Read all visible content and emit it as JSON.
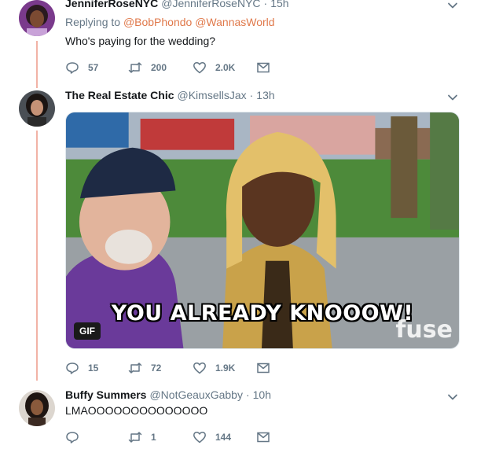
{
  "tweets": [
    {
      "name": "JenniferRoseNYC",
      "handle": "@JenniferRoseNYC",
      "separator": "·",
      "time": "15h",
      "reply_prefix": "Replying to",
      "mentions": [
        "@BobPhondo",
        "@WannasWorld"
      ],
      "text": "Who's paying for the wedding?",
      "stats": {
        "replies": "57",
        "retweets": "200",
        "likes": "2.0K"
      }
    },
    {
      "name": "The Real Estate Chic",
      "handle": "@KimsellsJax",
      "separator": "·",
      "time": "13h",
      "media": {
        "caption": "YOU ALREADY KNOOOW!",
        "badge": "GIF",
        "watermark": "fuse"
      },
      "stats": {
        "replies": "15",
        "retweets": "72",
        "likes": "1.9K"
      }
    },
    {
      "name": "Buffy Summers",
      "handle": "@NotGeauxGabby",
      "separator": "·",
      "time": "10h",
      "text": "LMAOOOOOOOOOOOOOO",
      "stats": {
        "replies": "",
        "retweets": "1",
        "likes": "144"
      }
    }
  ],
  "icons": {
    "reply": "reply-icon",
    "retweet": "retweet-icon",
    "like": "heart-icon",
    "message": "envelope-icon",
    "more": "chevron-down-icon"
  },
  "colors": {
    "mention": "#e0794b",
    "thread_line": "#f2b3a6",
    "muted": "#657786"
  }
}
